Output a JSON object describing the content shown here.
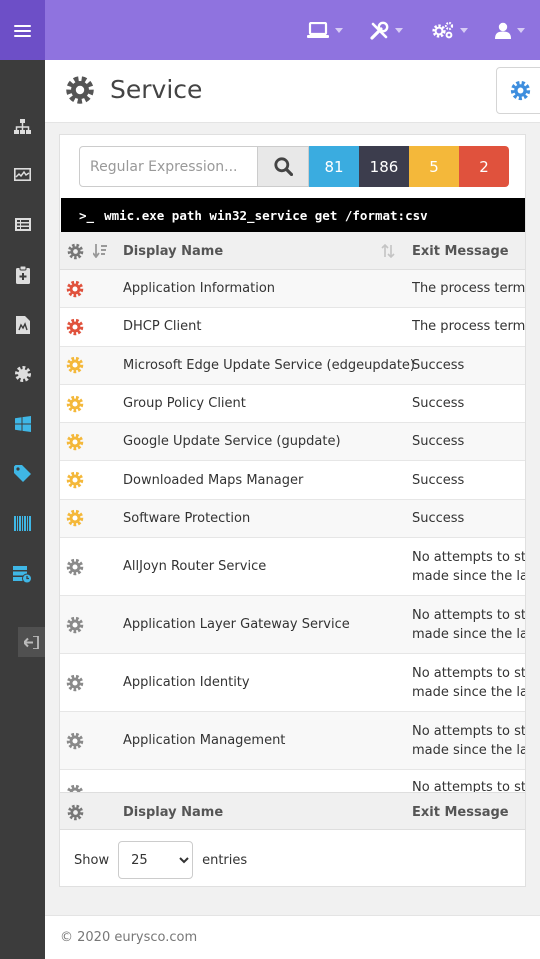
{
  "colors": {
    "navbar": "#8f73df",
    "brand": "#6d4fc7",
    "sidebar": "#3c3c3c",
    "count_info": "#3aace0",
    "count_dark": "#3c3d4d",
    "count_warning": "#f4b83a",
    "count_danger": "#e0523d",
    "status_error": "#e0523d",
    "status_warning": "#f4b83a",
    "status_info": "#8a8a8a",
    "accent": "#3e8ede"
  },
  "navbar": {
    "menu_icon": "bars-icon",
    "items": [
      {
        "icon": "laptop-icon"
      },
      {
        "icon": "tools-icon"
      },
      {
        "icon": "cogs-icon"
      },
      {
        "icon": "user-icon"
      }
    ]
  },
  "sidebar": {
    "items": [
      {
        "icon": "sitemap-icon"
      },
      {
        "icon": "chart-icon"
      },
      {
        "icon": "list-icon"
      },
      {
        "icon": "clipboard-icon"
      },
      {
        "icon": "file-icon"
      },
      {
        "icon": "gear-icon"
      },
      {
        "icon": "windows-icon"
      },
      {
        "icon": "tag-icon"
      },
      {
        "icon": "barcode-icon"
      },
      {
        "icon": "server-clock-icon"
      }
    ],
    "collapse_icon": "sign-out-icon"
  },
  "header": {
    "title": "Service",
    "icon": "gear-icon",
    "settings_icon": "gear-icon"
  },
  "search": {
    "placeholder": "Regular Expression...",
    "value": "",
    "counts": [
      "81",
      "186",
      "5",
      "2"
    ]
  },
  "command": {
    "prompt": ">_",
    "text": "wmic.exe path win32_service get /format:csv"
  },
  "table": {
    "columns": [
      "Display Name",
      "Exit Message"
    ],
    "rows": [
      {
        "status": "error",
        "name": "Application Information",
        "message": "The process termin"
      },
      {
        "status": "error",
        "name": "DHCP Client",
        "message": "The process termin"
      },
      {
        "status": "warning",
        "name": "Microsoft Edge Update Service (edgeupdate)",
        "message": "Success"
      },
      {
        "status": "warning",
        "name": "Group Policy Client",
        "message": "Success"
      },
      {
        "status": "warning",
        "name": "Google Update Service (gupdate)",
        "message": "Success"
      },
      {
        "status": "warning",
        "name": "Downloaded Maps Manager",
        "message": "Success"
      },
      {
        "status": "warning",
        "name": "Software Protection",
        "message": "Success"
      },
      {
        "status": "info",
        "name": "AllJoyn Router Service",
        "message": "No attempts to sta\nmade since the las"
      },
      {
        "status": "info",
        "name": "Application Layer Gateway Service",
        "message": "No attempts to sta\nmade since the las"
      },
      {
        "status": "info",
        "name": "Application Identity",
        "message": "No attempts to sta\nmade since the las"
      },
      {
        "status": "info",
        "name": "Application Management",
        "message": "No attempts to sta\nmade since the las"
      },
      {
        "status": "info",
        "name": "",
        "message": "No attempts to sta"
      }
    ]
  },
  "length": {
    "show": "Show",
    "value": "25",
    "options": [
      "25"
    ],
    "entries": "entries"
  },
  "footer": {
    "text": "© 2020  eurysco.com"
  }
}
